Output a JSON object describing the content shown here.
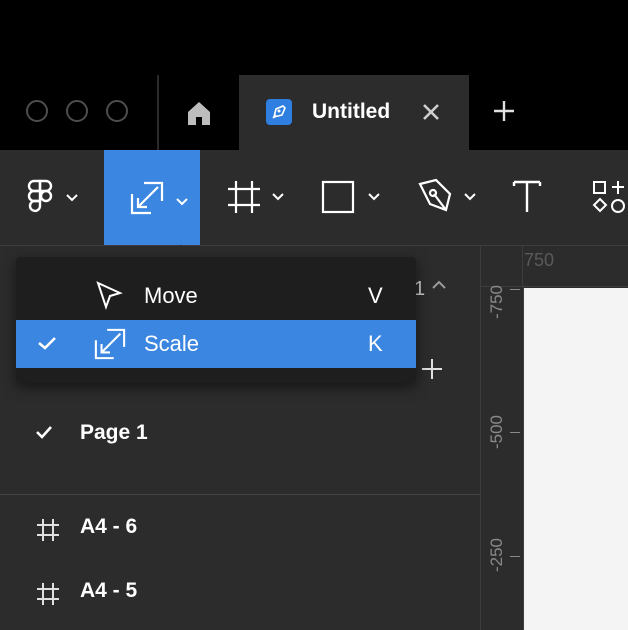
{
  "tabs": {
    "document_title": "Untitled"
  },
  "toolbar": {
    "tools": [
      "main-menu",
      "scale-tool",
      "frame-tool",
      "shape-tool",
      "pen-tool",
      "text-tool",
      "resources-tool"
    ],
    "active_tool": "scale-tool",
    "accent_color": "#3b86e0"
  },
  "move_dropdown": {
    "items": [
      {
        "label": "Move",
        "shortcut": "V",
        "selected": false
      },
      {
        "label": "Scale",
        "shortcut": "K",
        "selected": true
      }
    ]
  },
  "pages_panel": {
    "partial_count": "1",
    "pages": [
      {
        "label": "Page 1",
        "current": true
      }
    ]
  },
  "layers_panel": {
    "layers": [
      {
        "label": "A4 - 6"
      },
      {
        "label": "A4 - 5"
      }
    ]
  },
  "rulers": {
    "top_label": "750",
    "left_labels": [
      "-750",
      "-500",
      "-250"
    ]
  }
}
